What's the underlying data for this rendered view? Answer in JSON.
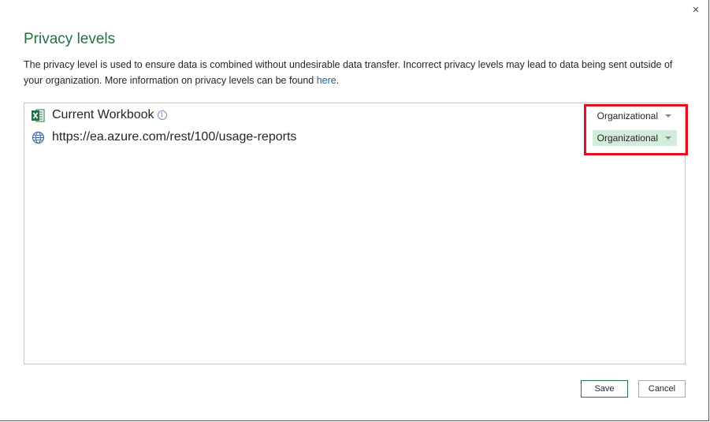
{
  "dialog": {
    "close_glyph": "×",
    "title": "Privacy levels",
    "description_text": "The privacy level is used to ensure data is combined without undesirable data transfer. Incorrect privacy levels may lead to data being sent outside of your organization. More information on privacy levels can be found ",
    "description_link": "here",
    "description_end": "."
  },
  "sources": [
    {
      "icon": "excel-icon",
      "name": "Current Workbook",
      "info_glyph": "i",
      "privacy_level": "Organizational",
      "selected": false
    },
    {
      "icon": "globe-icon",
      "name": "https://ea.azure.com/rest/100/usage-reports",
      "privacy_level": "Organizational",
      "selected": true
    }
  ],
  "buttons": {
    "save_label": "Save",
    "cancel_label": "Cancel"
  },
  "colors": {
    "accent": "#217346",
    "highlight": "#e0101e",
    "selected_bg": "#d3ecdc",
    "link": "#1a5c9e"
  }
}
